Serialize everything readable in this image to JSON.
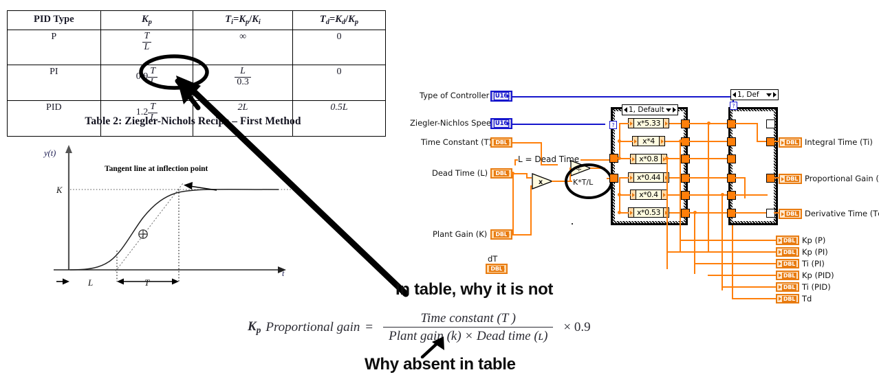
{
  "table": {
    "headers": [
      "PID Type",
      "Kp",
      "Ti=Kp/Ki",
      "Td=Kd/Kp"
    ],
    "rows": [
      {
        "type": "P",
        "kp_lead": "",
        "kp_num": "T",
        "kp_den": "L",
        "ti": "∞",
        "td": "0"
      },
      {
        "type": "PI",
        "kp_lead": "0.9",
        "kp_num": "T",
        "kp_den": "L",
        "ti_num": "L",
        "ti_den": "0.3",
        "td": "0"
      },
      {
        "type": "PID",
        "kp_lead": "1.2",
        "kp_num": "T",
        "kp_den": "L",
        "ti": "2L",
        "td": "0.5L"
      }
    ],
    "caption": "Table 2: Ziegler-Nichols Recipe – First Method"
  },
  "graph": {
    "y_axis_label": "y(t)",
    "x_axis_label": "t",
    "k_label": "K",
    "l_label": "L",
    "t_label": "T",
    "tangent_label": "Tangent line at inflection point"
  },
  "formula": {
    "kp_symbol": "Kp",
    "lhs": "Proportional gain",
    "equals": "=",
    "numerator": "Time constant (T )",
    "denominator": "Plant gain (k) × Dead time (ʟ)",
    "tail": "×  0.9"
  },
  "annotations": {
    "note_upper": "In table, why it is not",
    "note_lower": "Why absent in table",
    "circled_table_cell": "0.9 T/L",
    "circled_diagram_node": "K*T/L"
  },
  "labview": {
    "controls": [
      {
        "label": "Type of Controller",
        "type": "U16"
      },
      {
        "label": "Ziegler-Nichlos Speed",
        "type": "U16"
      },
      {
        "label": "Time Constant (T)",
        "type": "DBL"
      },
      {
        "label": "Dead Time (L)",
        "type": "DBL"
      },
      {
        "label": "Plant Gain (K)",
        "type": "DBL"
      },
      {
        "label": "dT",
        "type": "DBL"
      }
    ],
    "indicators": [
      {
        "label": "Integral Time (Ti)",
        "type": "DBL"
      },
      {
        "label": "Proportional Gain (Kp)",
        "type": "DBL"
      },
      {
        "label": "Derivative Time (Td)",
        "type": "DBL"
      },
      {
        "label": "Kp (P)",
        "type": "DBL"
      },
      {
        "label": "Kp (PI)",
        "type": "DBL"
      },
      {
        "label": "Ti (PI)",
        "type": "DBL"
      },
      {
        "label": "Kp (PID)",
        "type": "DBL"
      },
      {
        "label": "Ti (PID)",
        "type": "DBL"
      },
      {
        "label": "Td",
        "type": "DBL"
      }
    ],
    "case_structures": [
      {
        "selector": "1, Default"
      },
      {
        "selector": "1, Def"
      }
    ],
    "multiply_nodes": [
      "x*5.33",
      "x*4",
      "x*0.8",
      "x*0.44",
      "x*0.4",
      "x*0.53"
    ],
    "wire_label": "L = Dead Time",
    "function_nodes": [
      {
        "symbol": "x",
        "name": "multiply"
      },
      {
        "symbol": "÷",
        "name": "divide"
      }
    ],
    "node_annotation": "K*T/L",
    "colors": {
      "wire": "#ff7f0a",
      "bool_wire": "#1515cc",
      "dbl_border": "#e87b10",
      "u16_border": "#1515cc"
    }
  }
}
